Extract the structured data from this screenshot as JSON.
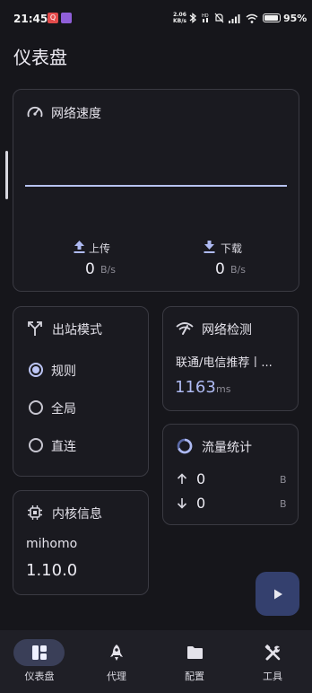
{
  "status_bar": {
    "time": "21:45",
    "notif_red_label": "Q",
    "net_speed_value": "2.06",
    "net_speed_unit": "KB/s",
    "battery_percent": "95%"
  },
  "page": {
    "title": "仪表盘"
  },
  "speed_card": {
    "title": "网络速度",
    "upload_label": "上传",
    "upload_value": "0",
    "upload_unit": "B/s",
    "download_label": "下载",
    "download_value": "0",
    "download_unit": "B/s"
  },
  "mode_card": {
    "title": "出站模式",
    "options": [
      {
        "label": "规则",
        "selected": true
      },
      {
        "label": "全局",
        "selected": false
      },
      {
        "label": "直连",
        "selected": false
      }
    ]
  },
  "network_card": {
    "title": "网络检测",
    "result": "联通/电信推荐丨...",
    "latency_value": "1163",
    "latency_unit": "ms"
  },
  "traffic_card": {
    "title": "流量统计",
    "up_value": "0",
    "up_unit": "B",
    "down_value": "0",
    "down_unit": "B"
  },
  "core_card": {
    "title": "内核信息",
    "name": "mihomo",
    "version": "1.10.0"
  },
  "bottom_nav": {
    "items": [
      {
        "label": "仪表盘",
        "icon": "dashboard-icon",
        "active": true
      },
      {
        "label": "代理",
        "icon": "rocket-icon",
        "active": false
      },
      {
        "label": "配置",
        "icon": "folder-icon",
        "active": false
      },
      {
        "label": "工具",
        "icon": "tools-icon",
        "active": false
      }
    ]
  },
  "colors": {
    "background": "#16161b",
    "card": "#1a1a20",
    "accent": "#aebaf2",
    "nav_pill": "#3a3f58",
    "fab": "#34406e"
  }
}
